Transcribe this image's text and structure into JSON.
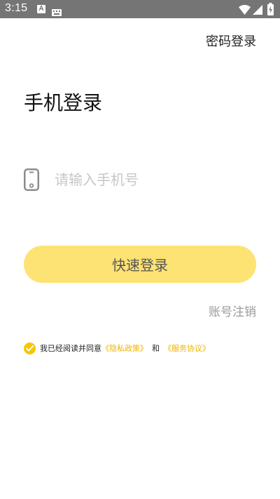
{
  "status_bar": {
    "time": "3:15",
    "icons": [
      "a-notification-icon",
      "keyboard-icon",
      "wifi-icon",
      "signal-icon",
      "battery-charging-icon"
    ]
  },
  "header": {
    "password_login": "密码登录"
  },
  "main": {
    "title": "手机登录",
    "phone_input": {
      "placeholder": "请输入手机号",
      "value": "",
      "icon": "phone-icon"
    },
    "quick_login_button": "快速登录",
    "account_cancel": "账号注销"
  },
  "agreement": {
    "checked": true,
    "text": "我已经阅读并同意",
    "privacy_link": "《隐私政策》",
    "and": "和",
    "service_link": "《服务协议》"
  },
  "colors": {
    "status_bar": "#757575",
    "accent_button": "#fde373",
    "checkbox": "#f6c700",
    "link": "#f0b400",
    "placeholder": "#c7c7c7",
    "muted_text": "#9a9a9a"
  }
}
